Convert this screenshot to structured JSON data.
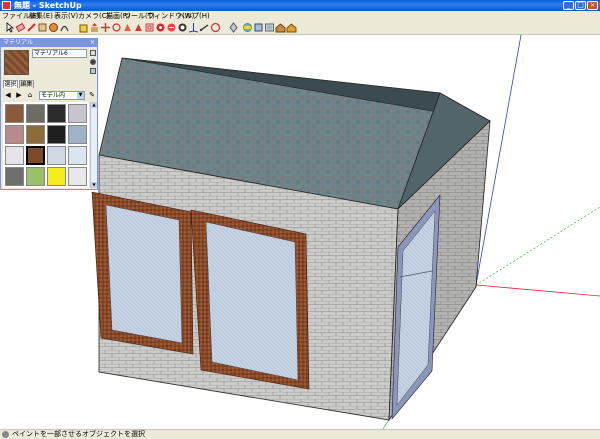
{
  "window": {
    "title": "無題 - SketchUp",
    "min": "_",
    "max": "□",
    "close": "×"
  },
  "menu": [
    "ファイル(F)",
    "編集(E)",
    "表示(V)",
    "カメラ(C)",
    "描画(R)",
    "ツール(T)",
    "ウィンドウ(W)",
    "ヘルプ(H)"
  ],
  "toolbar_icons": [
    "select-icon",
    "eraser-icon",
    "pencil-icon",
    "rectangle-icon",
    "circle-icon",
    "arc-icon",
    "paint-bucket-icon",
    "push-pull-icon",
    "move-icon",
    "rotate-icon",
    "follow-me-icon",
    "scale-icon",
    "offset-icon",
    "tape-measure-icon",
    "protractor-icon",
    "text-icon",
    "axes-icon",
    "dimension-icon",
    "orbit-icon",
    "pan-icon",
    "zoom-icon",
    "zoom-extents-icon",
    "previous-view-icon",
    "next-view-icon",
    "position-camera-icon",
    "walk-icon",
    "look-around-icon",
    "section-plane-icon",
    "get-models-icon",
    "share-model-icon",
    "component-icon",
    "warehouse-icon"
  ],
  "materials_panel": {
    "title": "マテリアル",
    "close": "×",
    "material_name": "マテリアル6",
    "tabs": [
      "選択",
      "編集"
    ],
    "library": "モデル内",
    "swatch_colors": [
      "#8a5a3a",
      "#6e6a64",
      "#2c2c2c",
      "#c9c3cf",
      "#b98a8a",
      "#8c6d3a",
      "#1f1f1f",
      "#9fb3c8",
      "#e6e4ea",
      "#7b4a2b",
      "#cfd9e3",
      "#d7e6ef",
      "#6f6f6f",
      "#9cbf6a",
      "#f2ef1c",
      "#e8e8ea"
    ]
  },
  "status": {
    "text": "ペイントを一部させるオブジェクトを選択"
  },
  "colors": {
    "title_bar": "#0b58c9",
    "chrome": "#ece9d8",
    "roof": "#6f8489",
    "wall": "#c8c8c6",
    "frame": "#8a4a2a",
    "glass": "#b9c9dd"
  }
}
